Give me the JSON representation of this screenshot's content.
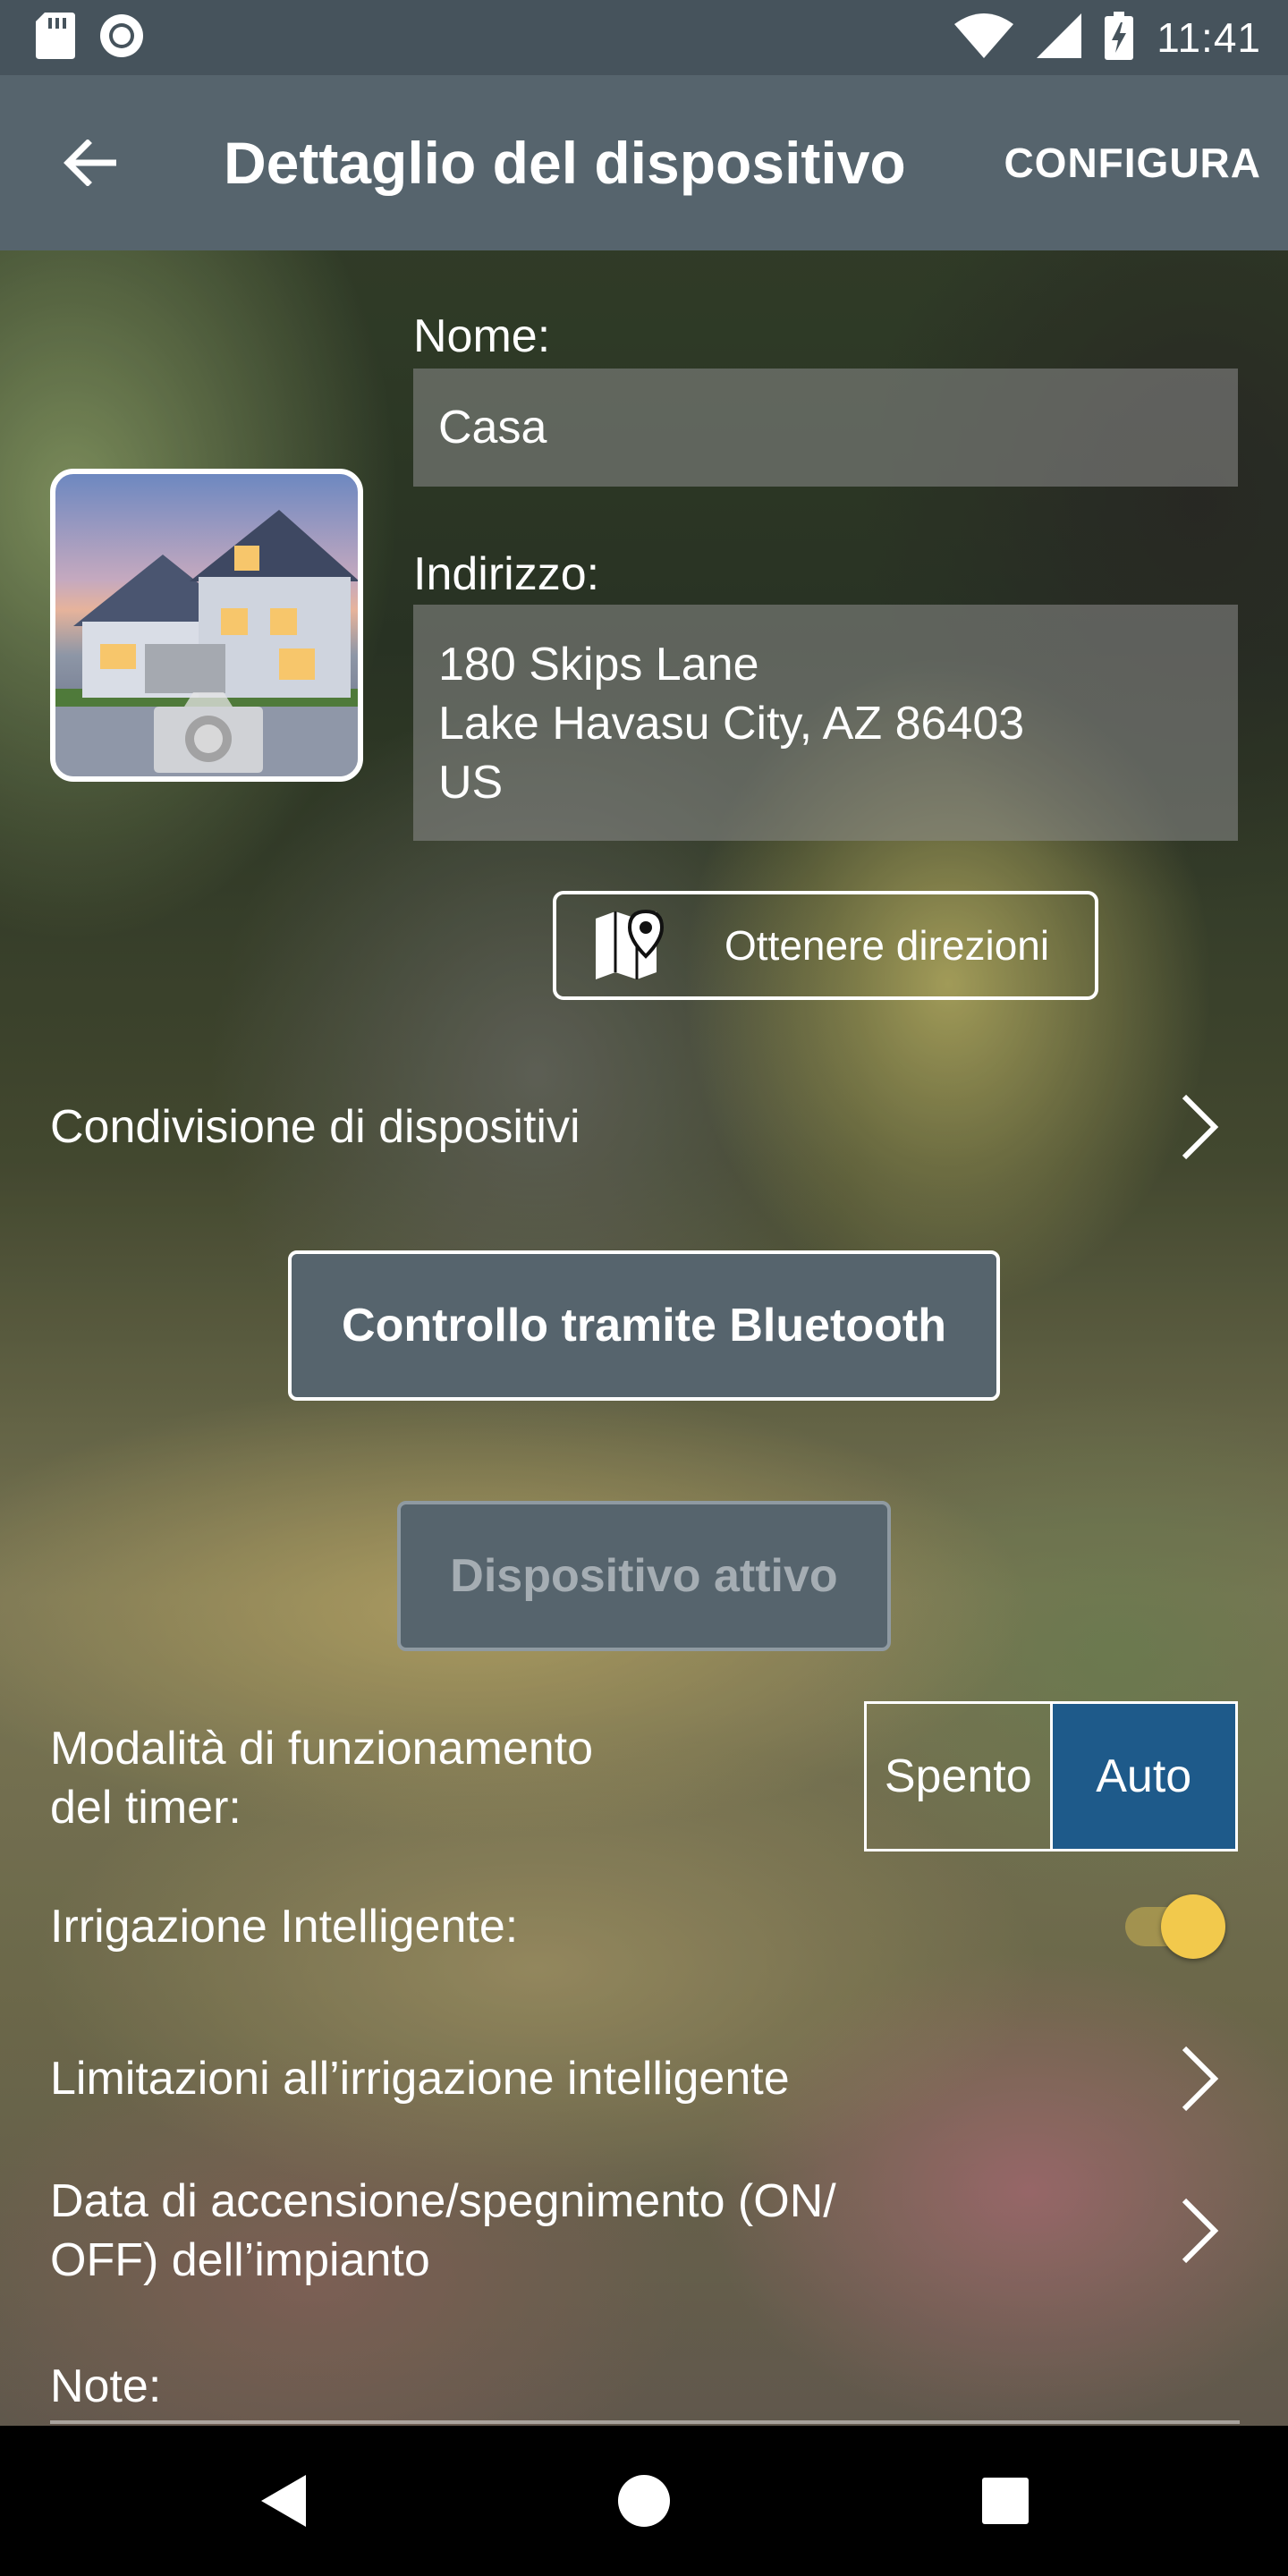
{
  "status_bar": {
    "time": "11:41",
    "icons": [
      "sd-card-icon",
      "record-icon",
      "wifi-icon",
      "signal-icon",
      "battery-charging-icon"
    ]
  },
  "app_bar": {
    "title": "Dettaglio del dispositivo",
    "action_label": "CONFIGURA",
    "back_icon": "arrow-back-icon"
  },
  "device": {
    "name_label": "Nome:",
    "name_value": "Casa",
    "address_label": "Indirizzo:",
    "address_lines": [
      "180 Skips Lane",
      "Lake Havasu City, AZ 86403",
      "US"
    ],
    "photo_icon": "camera-icon"
  },
  "directions_button": {
    "label": "Ottenere direzioni",
    "icon": "map-pin-icon"
  },
  "sharing": {
    "label": "Condivisione di dispositivi"
  },
  "bluetooth_button": {
    "label": "Controllo tramite Bluetooth"
  },
  "active_button": {
    "label": "Dispositivo attivo"
  },
  "timer_mode": {
    "label_line1": "Modalità di funzionamento",
    "label_line2": "del timer:",
    "options": [
      "Spento",
      "Auto"
    ],
    "selected": "Auto"
  },
  "smart_watering": {
    "label": "Irrigazione Intelligente:",
    "enabled": true
  },
  "smart_limits": {
    "label": "Limitazioni all’irrigazione intelligente"
  },
  "on_off_date": {
    "label_line1": "Data di accensione/spegnimento (ON/",
    "label_line2": "OFF) dell’impianto"
  },
  "notes": {
    "label": "Note:"
  },
  "colors": {
    "status_bar": "#46535c",
    "app_bar": "#56646d",
    "selected_segment": "#1e5a8a",
    "toggle_thumb": "#f2c94c"
  }
}
